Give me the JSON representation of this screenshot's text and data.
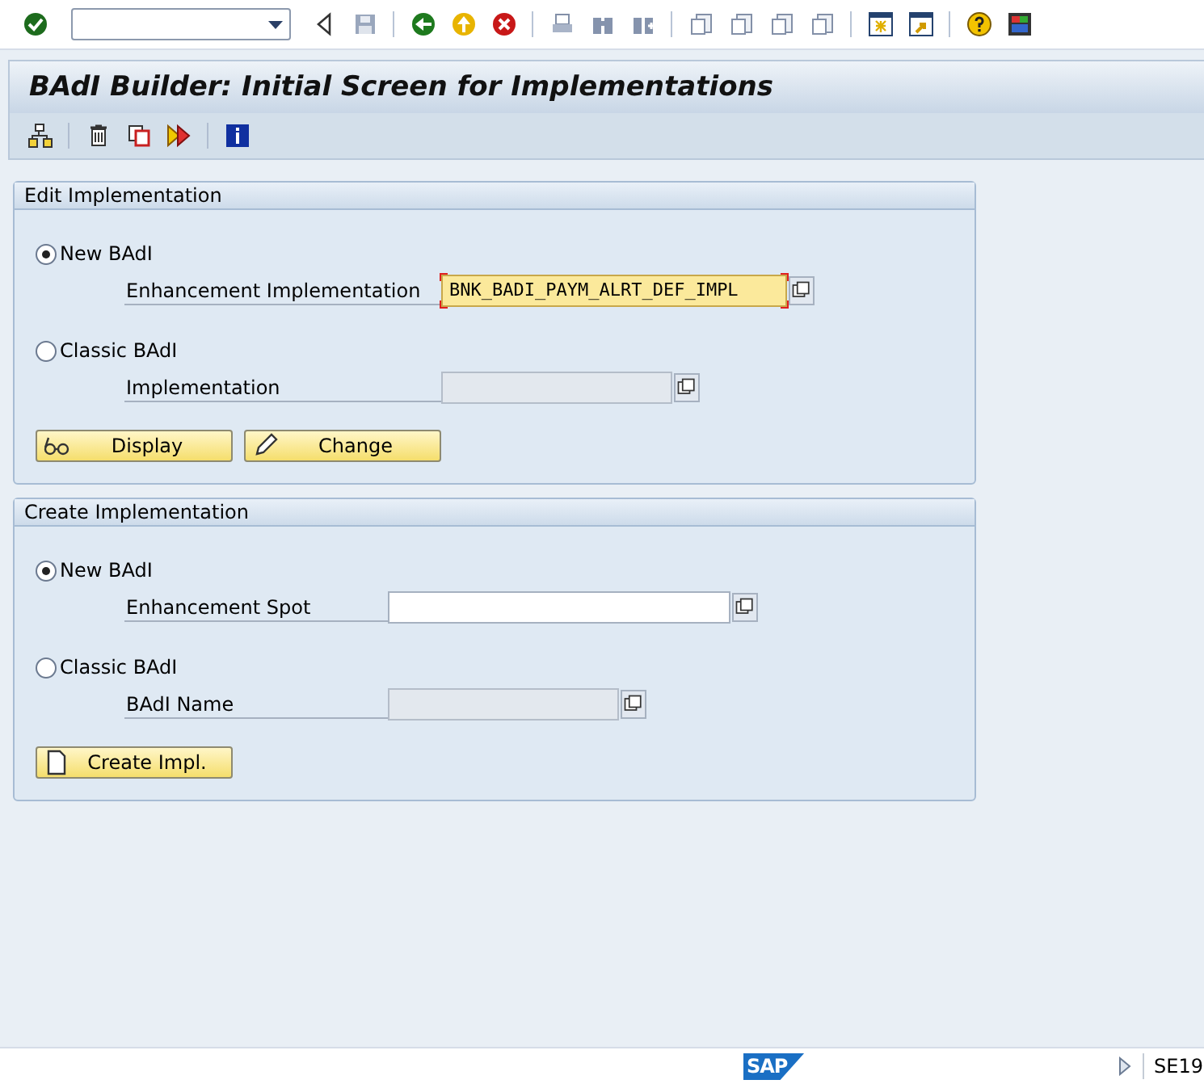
{
  "title": "BAdI Builder: Initial Screen for Implementations",
  "groups": [
    {
      "title": "Edit Implementation",
      "options": [
        {
          "label": "New BAdI",
          "selected": true,
          "field": {
            "label": "Enhancement Implementation",
            "value": "BNK_BADI_PAYM_ALRT_DEF_IMPL",
            "focused": true,
            "disabled": false
          }
        },
        {
          "label": "Classic BAdI",
          "selected": false,
          "field": {
            "label": "Implementation",
            "focused": false,
            "disabled": true
          }
        }
      ],
      "buttons": [
        {
          "label": "Display",
          "kind": "glasses"
        },
        {
          "label": "Change",
          "kind": "pencil"
        }
      ]
    },
    {
      "title": "Create Implementation",
      "options": [
        {
          "label": "New BAdI",
          "selected": true,
          "field": {
            "label": "Enhancement Spot",
            "focused": false,
            "disabled": false
          }
        },
        {
          "label": "Classic BAdI",
          "selected": false,
          "field": {
            "label": "BAdI Name",
            "focused": false,
            "disabled": true
          }
        }
      ],
      "buttons": [
        {
          "label": "Create Impl.",
          "kind": "page"
        }
      ]
    }
  ],
  "status_bar": {
    "logo": "SAP",
    "transaction": "SE19"
  }
}
